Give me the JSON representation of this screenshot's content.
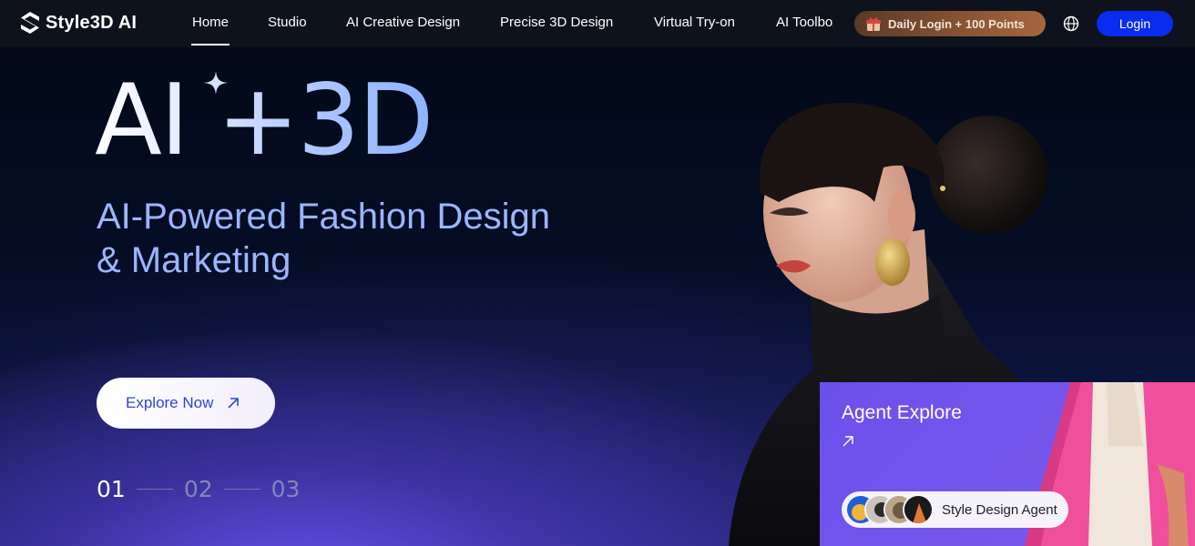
{
  "brand": {
    "name": "Style3D AI"
  },
  "nav": {
    "items": [
      {
        "label": "Home",
        "active": true
      },
      {
        "label": "Studio"
      },
      {
        "label": "AI Creative Design"
      },
      {
        "label": "Precise 3D Design"
      },
      {
        "label": "Virtual Try-on"
      },
      {
        "label": "AI Toolbox"
      }
    ],
    "daily_login": "Daily Login + 100 Points",
    "login": "Login"
  },
  "hero": {
    "headline": "AI +3D",
    "subtitle_line1": "AI-Powered Fashion Design",
    "subtitle_line2": "& Marketing",
    "cta": "Explore Now"
  },
  "pager": {
    "pages": [
      "01",
      "02",
      "03"
    ],
    "active_index": 0
  },
  "agent_card": {
    "title": "Agent Explore",
    "pill_label": "Style Design Agent"
  },
  "colors": {
    "login_blue": "#0a2cf0",
    "subtitle_blue": "#9cb5ff",
    "card_purple": "#6b50ea",
    "daily_bronze": "#8a5535"
  },
  "icons": {
    "logo": "s-logo-icon",
    "gift": "gift-icon",
    "globe": "globe-icon",
    "sparkle": "sparkle-icon",
    "arrow": "arrow-up-right-icon"
  }
}
